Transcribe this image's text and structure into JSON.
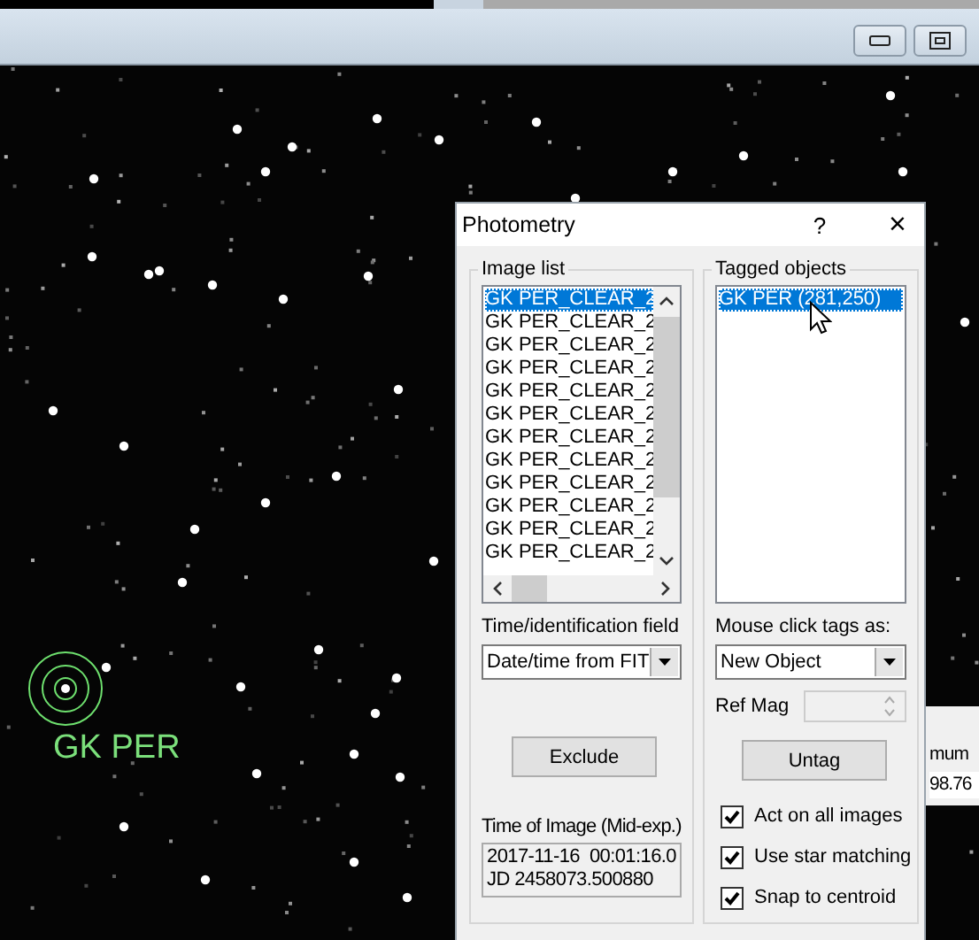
{
  "image_view": {
    "target_label": "GK PER"
  },
  "background_panel": {
    "texts": [
      "mum",
      "98.76"
    ]
  },
  "dialog": {
    "title": "Photometry",
    "help": "?",
    "close": "×",
    "image_list": {
      "label": "Image list",
      "items": [
        {
          "text": "GK PER_CLEAR_2",
          "selected": true
        },
        {
          "text": "GK PER_CLEAR_2",
          "selected": false
        },
        {
          "text": "GK PER_CLEAR_2",
          "selected": false
        },
        {
          "text": "GK PER_CLEAR_2",
          "selected": false
        },
        {
          "text": "GK PER_CLEAR_2",
          "selected": false
        },
        {
          "text": "GK PER_CLEAR_2",
          "selected": false
        },
        {
          "text": "GK PER_CLEAR_2",
          "selected": false
        },
        {
          "text": "GK PER_CLEAR_2",
          "selected": false
        },
        {
          "text": "GK PER_CLEAR_2",
          "selected": false
        },
        {
          "text": "GK PER_CLEAR_2",
          "selected": false
        },
        {
          "text": "GK PER_CLEAR_2",
          "selected": false
        },
        {
          "text": "GK PER_CLEAR_2",
          "selected": false
        }
      ]
    },
    "time_field": {
      "label": "Time/identification field",
      "value": "Date/time from FIT"
    },
    "exclude_button": "Exclude",
    "time_of_image": {
      "label": "Time of Image (Mid-exp.)",
      "lines": [
        "2017-11-16  00:01:16.0",
        "JD 2458073.500880"
      ]
    },
    "tagged_objects": {
      "label": "Tagged objects",
      "items": [
        {
          "text": "GK PER (281,250)",
          "selected": true
        }
      ]
    },
    "mouse_click": {
      "label": "Mouse click tags as:",
      "value": "New Object"
    },
    "ref_mag": {
      "label": "Ref Mag",
      "disabled": true
    },
    "untag_button": "Untag",
    "options": [
      {
        "label": "Act on all images",
        "checked": true
      },
      {
        "label": "Use star matching",
        "checked": true
      },
      {
        "label": "Snap to centroid",
        "checked": true
      }
    ]
  }
}
